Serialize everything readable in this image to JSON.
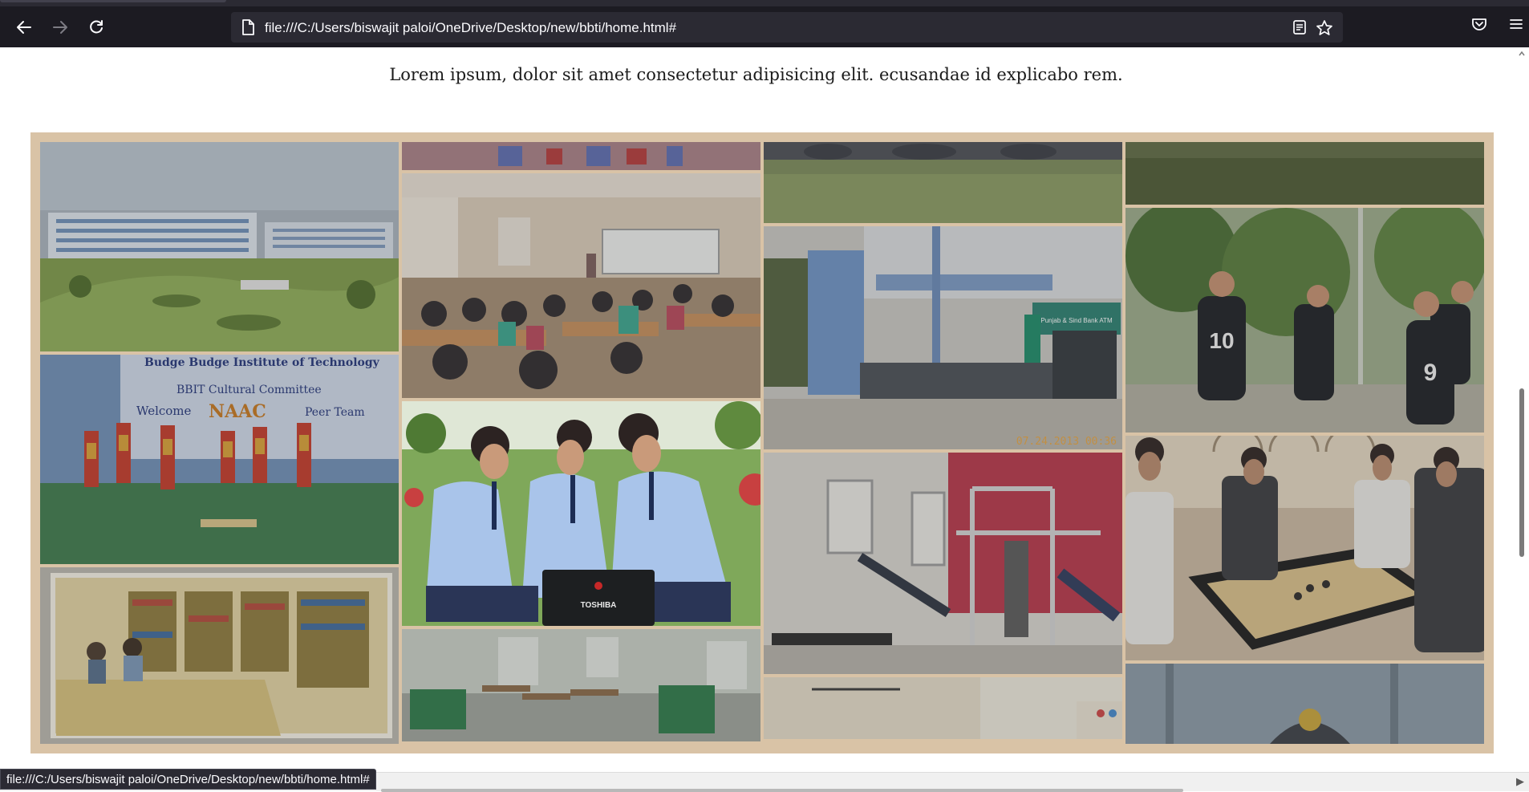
{
  "browser": {
    "url": "file:///C:/Users/biswajit paloi/OneDrive/Desktop/new/bbti/home.html#",
    "status_url": "file:///C:/Users/biswajit paloi/OneDrive/Desktop/new/bbti/home.html#"
  },
  "page": {
    "intro_text": "Lorem ipsum, dolor sit amet consectetur adipisicing elit. ecusandae id explicabo rem."
  },
  "gallery": {
    "banner": {
      "institute": "Budge Budge Institute of Technology",
      "committee": "BBIT Cultural Committee",
      "welcome": "Welcome",
      "naac": "NAAC",
      "team": "Peer Team"
    },
    "laptop_brand": "TOSHIBA",
    "timestamp": "07.24.2013 00:36",
    "atm_sign": "Punjab & Sind Bank ATM",
    "jersey_numbers": [
      "10",
      "9"
    ]
  },
  "colors": {
    "frame": "#d9c3a6",
    "chrome_bg": "#1c1b22",
    "urlbar_bg": "#2b2a33"
  }
}
